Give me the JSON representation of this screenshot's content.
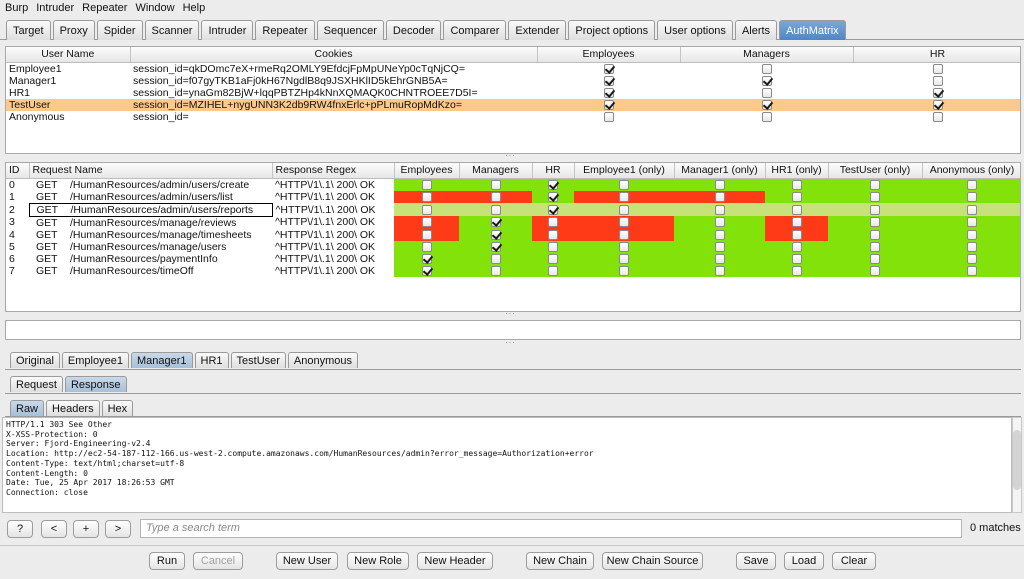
{
  "menu": [
    "Burp",
    "Intruder",
    "Repeater",
    "Window",
    "Help"
  ],
  "top_tabs": [
    "Target",
    "Proxy",
    "Spider",
    "Scanner",
    "Intruder",
    "Repeater",
    "Sequencer",
    "Decoder",
    "Comparer",
    "Extender",
    "Project options",
    "User options",
    "Alerts",
    "AuthMatrix"
  ],
  "active_top_tab": "AuthMatrix",
  "users_table": {
    "headers": [
      "User Name",
      "Cookies",
      "Employees",
      "Managers",
      "HR"
    ],
    "rows": [
      {
        "name": "Employee1",
        "cookie": "session_id=qkDOmc7eX+rmeRq2OMLY9EfdcjFpMpUNeYp0cTqNjCQ=",
        "roles": [
          true,
          false,
          false
        ]
      },
      {
        "name": "Manager1",
        "cookie": "session_id=f07gyTKB1aFj0kH67NgdlB8q9JSXHKlID5kEhrGNB5A=",
        "roles": [
          true,
          true,
          false
        ]
      },
      {
        "name": "HR1",
        "cookie": "session_id=ynaGm82BjW+lqqPBTZHp4kNnXQMAQK0CHNTROEE7D5I=",
        "roles": [
          true,
          false,
          true
        ]
      },
      {
        "name": "TestUser",
        "cookie": "session_id=MZIHEL+nygUNN3K2db9RW4fnxErlc+pPLmuRopMdKzo=",
        "roles": [
          true,
          true,
          true
        ],
        "selected": true
      },
      {
        "name": "Anonymous",
        "cookie": "session_id=",
        "roles": [
          false,
          false,
          false
        ]
      }
    ]
  },
  "requests_table": {
    "headers": [
      "ID",
      "Request Name",
      "Response Regex",
      "Employees",
      "Managers",
      "HR",
      "Employee1 (only)",
      "Manager1 (only)",
      "HR1 (only)",
      "TestUser (only)",
      "Anonymous (only)"
    ],
    "rows": [
      {
        "id": "0",
        "method": "GET",
        "path": "/HumanResources/admin/users/create",
        "regex": "^HTTP\\/1\\.1\\ 200\\ OK",
        "checks": [
          false,
          false,
          true,
          false,
          false,
          false,
          false,
          false
        ],
        "colors": [
          "g",
          "g",
          "g",
          "g",
          "g",
          "g",
          "g",
          "g"
        ]
      },
      {
        "id": "1",
        "method": "GET",
        "path": "/HumanResources/admin/users/list",
        "regex": "^HTTP\\/1\\.1\\ 200\\ OK",
        "checks": [
          false,
          false,
          true,
          false,
          false,
          false,
          false,
          false
        ],
        "colors": [
          "r",
          "r",
          "g",
          "r",
          "r",
          "g",
          "g",
          "g"
        ]
      },
      {
        "id": "2",
        "method": "GET",
        "path": "/HumanResources/admin/users/reports",
        "regex": "^HTTP\\/1\\.1\\ 200\\ OK",
        "checks": [
          false,
          false,
          true,
          false,
          false,
          false,
          false,
          false
        ],
        "colors": [
          "g",
          "g",
          "g",
          "g",
          "g",
          "g",
          "g",
          "g"
        ],
        "editing": true
      },
      {
        "id": "3",
        "method": "GET",
        "path": "/HumanResources/manage/reviews",
        "regex": "^HTTP\\/1\\.1\\ 200\\ OK",
        "checks": [
          false,
          true,
          false,
          false,
          false,
          false,
          false,
          false
        ],
        "colors": [
          "r",
          "g",
          "r",
          "r",
          "g",
          "r",
          "g",
          "g"
        ]
      },
      {
        "id": "4",
        "method": "GET",
        "path": "/HumanResources/manage/timesheets",
        "regex": "^HTTP\\/1\\.1\\ 200\\ OK",
        "checks": [
          false,
          true,
          false,
          false,
          false,
          false,
          false,
          false
        ],
        "colors": [
          "r",
          "g",
          "r",
          "r",
          "g",
          "r",
          "g",
          "g"
        ]
      },
      {
        "id": "5",
        "method": "GET",
        "path": "/HumanResources/manage/users",
        "regex": "^HTTP\\/1\\.1\\ 200\\ OK",
        "checks": [
          false,
          true,
          false,
          false,
          false,
          false,
          false,
          false
        ],
        "colors": [
          "g",
          "g",
          "g",
          "g",
          "g",
          "g",
          "g",
          "g"
        ]
      },
      {
        "id": "6",
        "method": "GET",
        "path": "/HumanResources/paymentInfo",
        "regex": "^HTTP\\/1\\.1\\ 200\\ OK",
        "checks": [
          true,
          false,
          false,
          false,
          false,
          false,
          false,
          false
        ],
        "colors": [
          "g",
          "g",
          "g",
          "g",
          "g",
          "g",
          "g",
          "g"
        ]
      },
      {
        "id": "7",
        "method": "GET",
        "path": "/HumanResources/timeOff",
        "regex": "^HTTP\\/1\\.1\\ 200\\ OK",
        "checks": [
          true,
          false,
          false,
          false,
          false,
          false,
          false,
          false
        ],
        "colors": [
          "g",
          "g",
          "g",
          "g",
          "g",
          "g",
          "g",
          "g"
        ]
      }
    ]
  },
  "user_tabs": [
    "Original",
    "Employee1",
    "Manager1",
    "HR1",
    "TestUser",
    "Anonymous"
  ],
  "active_user_tab": "Manager1",
  "reqresp_tabs": [
    "Request",
    "Response"
  ],
  "active_reqresp_tab": "Response",
  "view_tabs": [
    "Raw",
    "Headers",
    "Hex"
  ],
  "active_view_tab": "Raw",
  "response_lines": [
    "HTTP/1.1 303 See Other",
    "X-XSS-Protection: 0",
    "Server: Fjord-Engineering-v2.4",
    "Location: http://ec2-54-187-112-166.us-west-2.compute.amazonaws.com/HumanResources/admin?error_message=Authorization+error",
    "Content-Type: text/html;charset=utf-8",
    "Content-Length: 0",
    "Date: Tue, 25 Apr 2017 18:26:53 GMT",
    "Connection: close"
  ],
  "search": {
    "help_label": "?",
    "prev_label": "<",
    "add_label": "+",
    "next_label": ">",
    "placeholder": "Type a search term",
    "matches": "0 matches"
  },
  "bottom_buttons": {
    "run": "Run",
    "cancel": "Cancel",
    "new_user": "New User",
    "new_role": "New Role",
    "new_header": "New Header",
    "new_chain": "New Chain",
    "new_chain_source": "New Chain Source",
    "save": "Save",
    "load": "Load",
    "clear": "Clear"
  },
  "colors": {
    "pass": "#83e20a",
    "fail": "#ff3a17",
    "selected_row": "#fbc98c",
    "active_tab": "#4e86c4"
  }
}
